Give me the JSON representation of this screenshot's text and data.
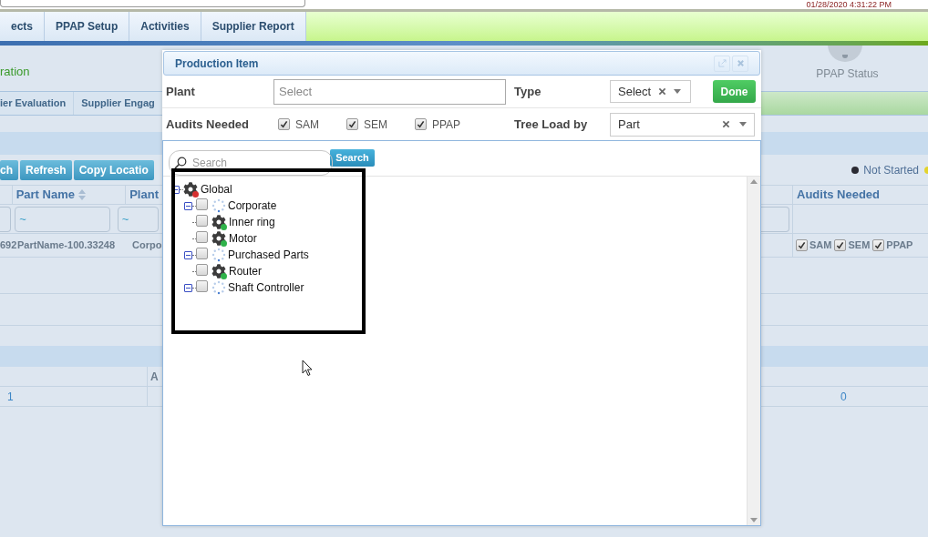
{
  "top_bar": {
    "datetime": "01/28/2020 4:31:22 PM"
  },
  "nav_tabs": [
    "ects",
    "PPAP Setup",
    "Activities",
    "Supplier Report"
  ],
  "left_panel": {
    "title": "ration",
    "sub_tabs": [
      "ier Evaluation",
      "Supplier Engag"
    ],
    "buttons": [
      "ch",
      "Refresh",
      "Copy Locatio"
    ],
    "columns": [
      "",
      "Part Name",
      "Plant"
    ],
    "filters": [
      "~",
      "~"
    ],
    "rows": [
      [
        "692",
        "PartName-100.33248",
        "Corpo"
      ]
    ],
    "lower_grid": {
      "columns": [
        "A"
      ],
      "rows": [
        [
          "1"
        ]
      ]
    }
  },
  "right_panel": {
    "status_label": "PPAP Status",
    "legend": [
      {
        "label": "Not Started",
        "color": "#2b2b33"
      },
      {
        "color": "#e3d32c"
      }
    ],
    "column": "Audits Needed",
    "audits": [
      {
        "label": "SAM",
        "checked": true
      },
      {
        "label": "SEM",
        "checked": true
      },
      {
        "label": "PPAP",
        "checked": true
      }
    ],
    "lower_value": "0"
  },
  "dialog": {
    "title": "Production Item",
    "plant": {
      "label": "Plant",
      "placeholder": "Select"
    },
    "type": {
      "label": "Type",
      "value": "Select"
    },
    "done": "Done",
    "audits_label": "Audits Needed",
    "audits": [
      {
        "label": "SAM",
        "checked": true
      },
      {
        "label": "SEM",
        "checked": true
      },
      {
        "label": "PPAP",
        "checked": true
      }
    ],
    "tree_load": {
      "label": "Tree Load by",
      "value": "Part"
    },
    "search": {
      "placeholder": "Search",
      "button": "Search"
    },
    "tree": {
      "label": "Global",
      "kind": "root",
      "expanded": true,
      "children": [
        {
          "label": "Corporate",
          "kind": "folder",
          "expanded": true,
          "checked": false
        },
        {
          "label": "Inner ring",
          "kind": "part",
          "checked": false
        },
        {
          "label": "Motor",
          "kind": "part",
          "checked": false
        },
        {
          "label": "Purchased Parts",
          "kind": "folder",
          "expanded": true,
          "checked": false
        },
        {
          "label": "Router",
          "kind": "part",
          "checked": false
        },
        {
          "label": "Shaft Controller",
          "kind": "folder",
          "expanded": true,
          "checked": false
        }
      ]
    }
  }
}
